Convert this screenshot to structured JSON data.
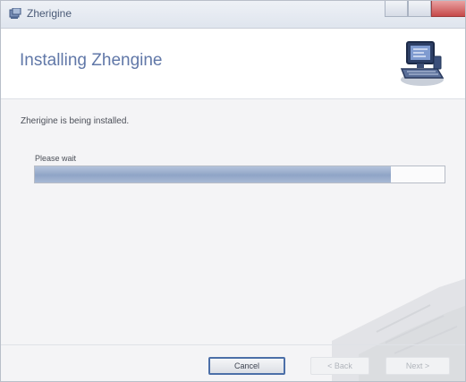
{
  "window": {
    "title": "Zherigine",
    "title_icon": "app-icon"
  },
  "header": {
    "heading": "Installing Zhengine",
    "logo_icon": "installer-computer-icon"
  },
  "main": {
    "status_text": "Zherigine is being installed.",
    "progress_label": "Please wait",
    "progress_fraction": 0.87
  },
  "footer": {
    "cancel_label": "Cancel",
    "back_label": "< Back",
    "next_label": "Next >"
  },
  "colors": {
    "heading": "#6178a8",
    "progress_fill": "#8fa4c6",
    "default_button_border": "#4c6fa8"
  }
}
